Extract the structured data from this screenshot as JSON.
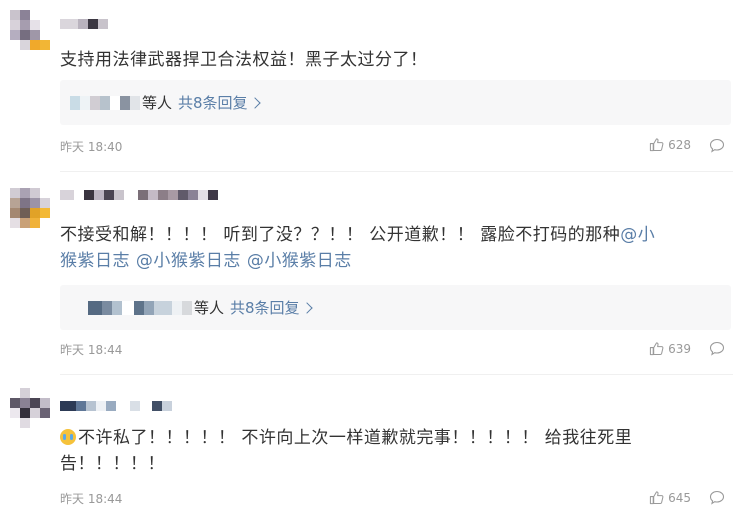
{
  "comments": [
    {
      "text": "支持用法律武器捍卫合法权益！黑子太过分了！",
      "reply_etc": "等人",
      "reply_link": "共8条回复",
      "time": "昨天 18:40",
      "likes": "628"
    },
    {
      "text_plain": "不接受和解！！！！ 听到了没？？！！ 公开道歉！！ 露脸不打码的那种",
      "mention_1": "@小",
      "line2_mention_a": "猴紫日志",
      "line2_mention_b": "@小猴紫日志",
      "line2_mention_c": "@小猴紫日志",
      "reply_etc": "等人",
      "reply_link": "共8条回复",
      "time": "昨天 18:44",
      "likes": "639"
    },
    {
      "emoji_name": "crying-face-emoji",
      "line1": "不许私了！！！！！ 不许向上次一样道歉就完事！！！！！ 给我往死里",
      "line2": "告！！！！！",
      "time": "昨天 18:44",
      "likes": "645"
    }
  ],
  "icons": {
    "like": "thumbs-up-icon",
    "reply": "comment-bubble-icon"
  },
  "colors": {
    "link": "#5a7ea7",
    "meta": "#999999",
    "reply_bg": "#f7f7f8"
  }
}
